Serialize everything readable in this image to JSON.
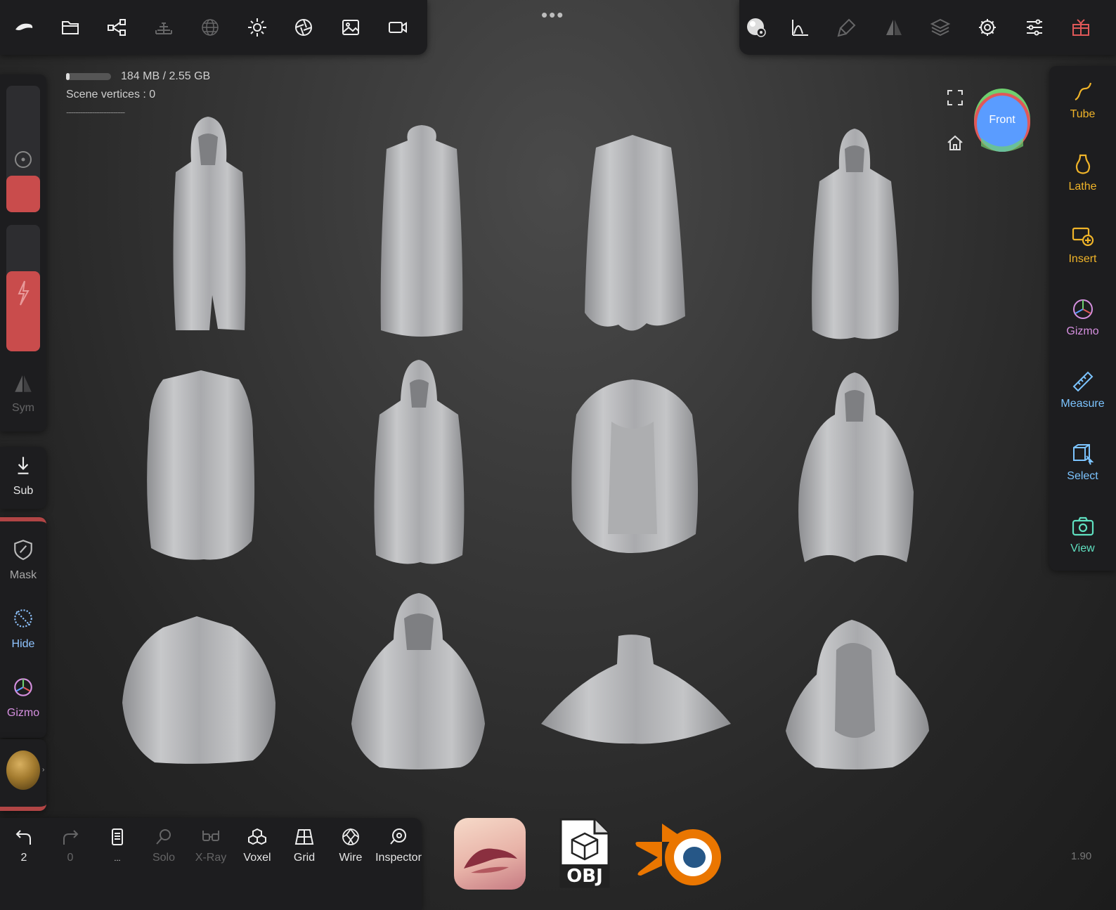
{
  "top_left_toolbar": [
    {
      "name": "nomad-logo-icon",
      "dim": false
    },
    {
      "name": "folder-icon",
      "dim": false
    },
    {
      "name": "scene-graph-icon",
      "dim": false
    },
    {
      "name": "brick-icon",
      "dim": true
    },
    {
      "name": "sphere-grid-icon",
      "dim": true
    },
    {
      "name": "sun-icon",
      "dim": false
    },
    {
      "name": "aperture-icon",
      "dim": false
    },
    {
      "name": "image-icon",
      "dim": false
    },
    {
      "name": "video-camera-icon",
      "dim": false
    }
  ],
  "top_right_toolbar": [
    {
      "name": "material-sphere-icon",
      "dim": false
    },
    {
      "name": "curve-icon",
      "dim": false
    },
    {
      "name": "paint-icon",
      "dim": true
    },
    {
      "name": "symmetry-icon",
      "dim": true
    },
    {
      "name": "layers-icon",
      "dim": true
    },
    {
      "name": "gear-icon",
      "dim": false
    },
    {
      "name": "sliders-icon",
      "dim": false
    },
    {
      "name": "gift-icon",
      "dim": false
    }
  ],
  "status": {
    "memory": "184 MB / 2.55 GB",
    "vertices": "Scene vertices : 0",
    "dashes": "-------------------------"
  },
  "left_panel": {
    "sym_label": "Sym",
    "sub_label": "Sub",
    "mask_label": "Mask",
    "hide_label": "Hide",
    "gizmo_label": "Gizmo"
  },
  "right_panel": [
    {
      "label": "Tube",
      "color": "#f0b429",
      "icon": "tube-icon"
    },
    {
      "label": "Lathe",
      "color": "#f0b429",
      "icon": "lathe-icon"
    },
    {
      "label": "Insert",
      "color": "#f0b429",
      "icon": "insert-icon"
    },
    {
      "label": "Gizmo",
      "color": "#d690e0",
      "icon": "gizmo-icon"
    },
    {
      "label": "Measure",
      "color": "#7cc4ff",
      "icon": "ruler-icon"
    },
    {
      "label": "Select",
      "color": "#7cc4ff",
      "icon": "select-icon"
    },
    {
      "label": "View",
      "color": "#5fe0c0",
      "icon": "camera-icon"
    }
  ],
  "view_cube": {
    "label": "Front"
  },
  "bottom_bar": {
    "undo_count": "2",
    "redo_count": "0",
    "more_label": "...",
    "solo_label": "Solo",
    "xray_label": "X-Ray",
    "voxel_label": "Voxel",
    "grid_label": "Grid",
    "wire_label": "Wire",
    "inspector_label": "Inspector"
  },
  "logos": {
    "obj_label": "OBJ"
  },
  "version": "1.90",
  "colors": {
    "accent_red": "#c94c4c",
    "panel_bg": "#1d1d1f",
    "model_gray": "#bfc0c2"
  }
}
